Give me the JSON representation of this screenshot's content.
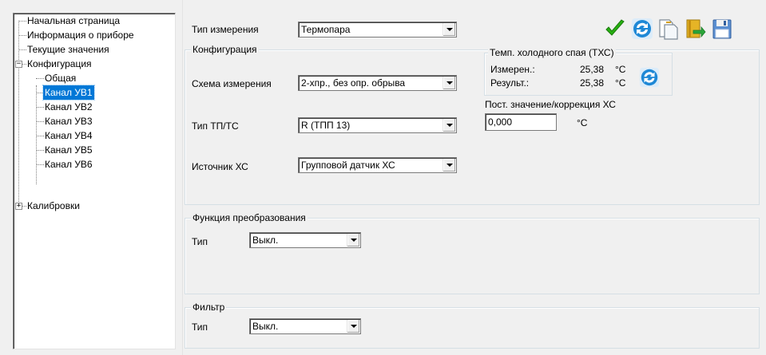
{
  "tree": {
    "items": [
      {
        "label": "Начальная страница"
      },
      {
        "label": "Информация о приборе"
      },
      {
        "label": "Текущие значения"
      },
      {
        "label": "Конфигурация",
        "expander": "−"
      },
      {
        "label": "Общая"
      },
      {
        "label": "Канал УВ1",
        "selected": true
      },
      {
        "label": "Канал УВ2"
      },
      {
        "label": "Канал УВ3"
      },
      {
        "label": "Канал УВ4"
      },
      {
        "label": "Канал УВ5"
      },
      {
        "label": "Канал УВ6"
      },
      {
        "label": "Калибровки",
        "expander": "+"
      }
    ]
  },
  "measurement_type": {
    "label": "Тип измерения",
    "value": "Термопара"
  },
  "toolbar": {
    "icons": [
      "checkmark-icon",
      "refresh-icon",
      "copy-document-icon",
      "export-book-icon",
      "save-floppy-icon"
    ]
  },
  "config": {
    "title": "Конфигурация",
    "scheme": {
      "label": "Схема измерения",
      "value": "2-хпр., без опр. обрыва"
    },
    "tp_type": {
      "label": "Тип ТП/ТС",
      "value": "R (ТПП 13)"
    },
    "cj_source": {
      "label": "Источник ХС",
      "value": "Групповой датчик ХС"
    },
    "cj": {
      "title": "Темп. холодного спая (ТХС)",
      "measured_label": "Измерен.:",
      "measured_value": "25,38",
      "measured_unit": "°С",
      "result_label": "Результ.:",
      "result_value": "25,38",
      "result_unit": "°С"
    },
    "const_label": "Пост. значение/коррекция ХС",
    "const_value": "0,000",
    "const_unit": "°С"
  },
  "function": {
    "title": "Функция преобразования",
    "type_label": "Тип",
    "type_value": "Выкл."
  },
  "filter": {
    "title": "Фильтр",
    "type_label": "Тип",
    "type_value": "Выкл."
  },
  "colors": {
    "selection": "#0078d7",
    "check": "#27b012",
    "refresh": "#1e88d6"
  }
}
